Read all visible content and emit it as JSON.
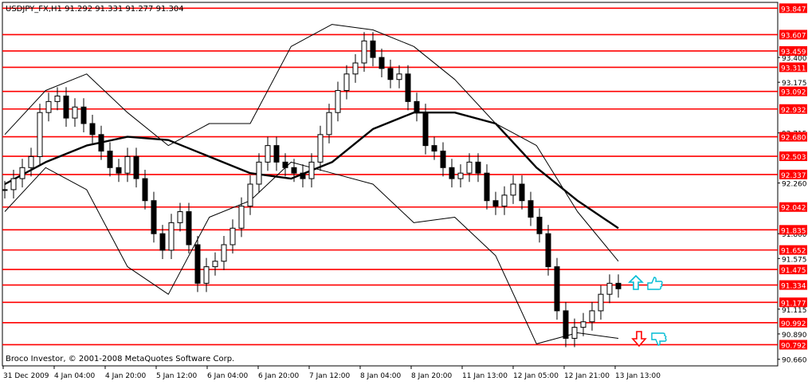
{
  "window": {
    "header": "USDJPY_FX,H1  91.292 91.331 91.277 91.304"
  },
  "copyright": "Broco Investor, © 2001-2008 MetaQuotes Software Corp.",
  "colors": {
    "level_line": "#ff0000",
    "candle": "#000000",
    "price_tag": "#ff0000",
    "price_tag_text": "#ffffff",
    "arrow_up": "#00bcd4",
    "arrow_down": "#ff0000",
    "hand": "#00bcd4"
  },
  "icons": {
    "up_signal": "arrow-up-icon",
    "down_signal": "arrow-down-icon",
    "hand_up": "thumbs-up-icon",
    "hand_down": "thumbs-down-icon"
  },
  "chart_data": {
    "type": "candlestick",
    "symbol": "USDJPY_FX",
    "timeframe": "H1",
    "header_ohlc": {
      "open": 91.292,
      "high": 91.331,
      "low": 91.277,
      "close": 91.304
    },
    "ylim": [
      90.6,
      93.9
    ],
    "grid": false,
    "x_tick_labels": [
      "31 Dec 2009",
      "4 Jan 04:00",
      "4 Jan 20:00",
      "5 Jan 12:00",
      "6 Jan 04:00",
      "6 Jan 20:00",
      "7 Jan 12:00",
      "8 Jan 04:00",
      "8 Jan 20:00",
      "11 Jan 13:00",
      "12 Jan 05:00",
      "12 Jan 21:00",
      "13 Jan 13:00"
    ],
    "y_tick_labels": [
      "93.400",
      "93.175",
      "92.715",
      "92.260",
      "91.800",
      "91.575",
      "91.115",
      "90.890",
      "90.660"
    ],
    "levels": [
      "93.847",
      "93.607",
      "93.459",
      "93.311",
      "93.092",
      "92.932",
      "92.680",
      "92.503",
      "92.337",
      "92.042",
      "91.835",
      "91.652",
      "91.475",
      "91.334",
      "91.177",
      "90.992",
      "90.792"
    ],
    "close_path": [
      92.2,
      92.3,
      92.4,
      92.5,
      92.9,
      93.0,
      93.05,
      92.85,
      92.95,
      92.8,
      92.7,
      92.55,
      92.4,
      92.35,
      92.5,
      92.3,
      92.1,
      91.8,
      91.65,
      91.9,
      92.0,
      91.7,
      91.35,
      91.5,
      91.55,
      91.7,
      91.85,
      92.05,
      92.25,
      92.45,
      92.6,
      92.45,
      92.4,
      92.35,
      92.3,
      92.45,
      92.7,
      92.9,
      93.1,
      93.25,
      93.35,
      93.55,
      93.4,
      93.3,
      93.2,
      93.25,
      93.0,
      92.9,
      92.6,
      92.55,
      92.4,
      92.3,
      92.35,
      92.45,
      92.35,
      92.1,
      92.05,
      92.15,
      92.25,
      92.1,
      91.95,
      91.8,
      91.5,
      91.1,
      90.85,
      90.95,
      91.0,
      91.1,
      91.25,
      91.35,
      91.3
    ],
    "series": [
      {
        "name": "MA",
        "values": [
          92.25,
          92.45,
          92.6,
          92.68,
          92.65,
          92.5,
          92.35,
          92.3,
          92.45,
          92.75,
          92.9,
          92.9,
          92.8,
          92.4,
          92.1,
          91.85
        ]
      },
      {
        "name": "Upper Band",
        "values": [
          92.7,
          93.1,
          93.25,
          92.9,
          92.6,
          92.8,
          92.8,
          93.5,
          93.7,
          93.65,
          93.5,
          93.2,
          92.8,
          92.6,
          92.0,
          91.55
        ]
      },
      {
        "name": "Lower Band",
        "values": [
          92.0,
          92.4,
          92.2,
          91.5,
          91.25,
          91.95,
          92.1,
          92.45,
          92.35,
          92.25,
          91.9,
          91.95,
          91.6,
          90.8,
          90.9,
          90.85
        ]
      }
    ]
  }
}
